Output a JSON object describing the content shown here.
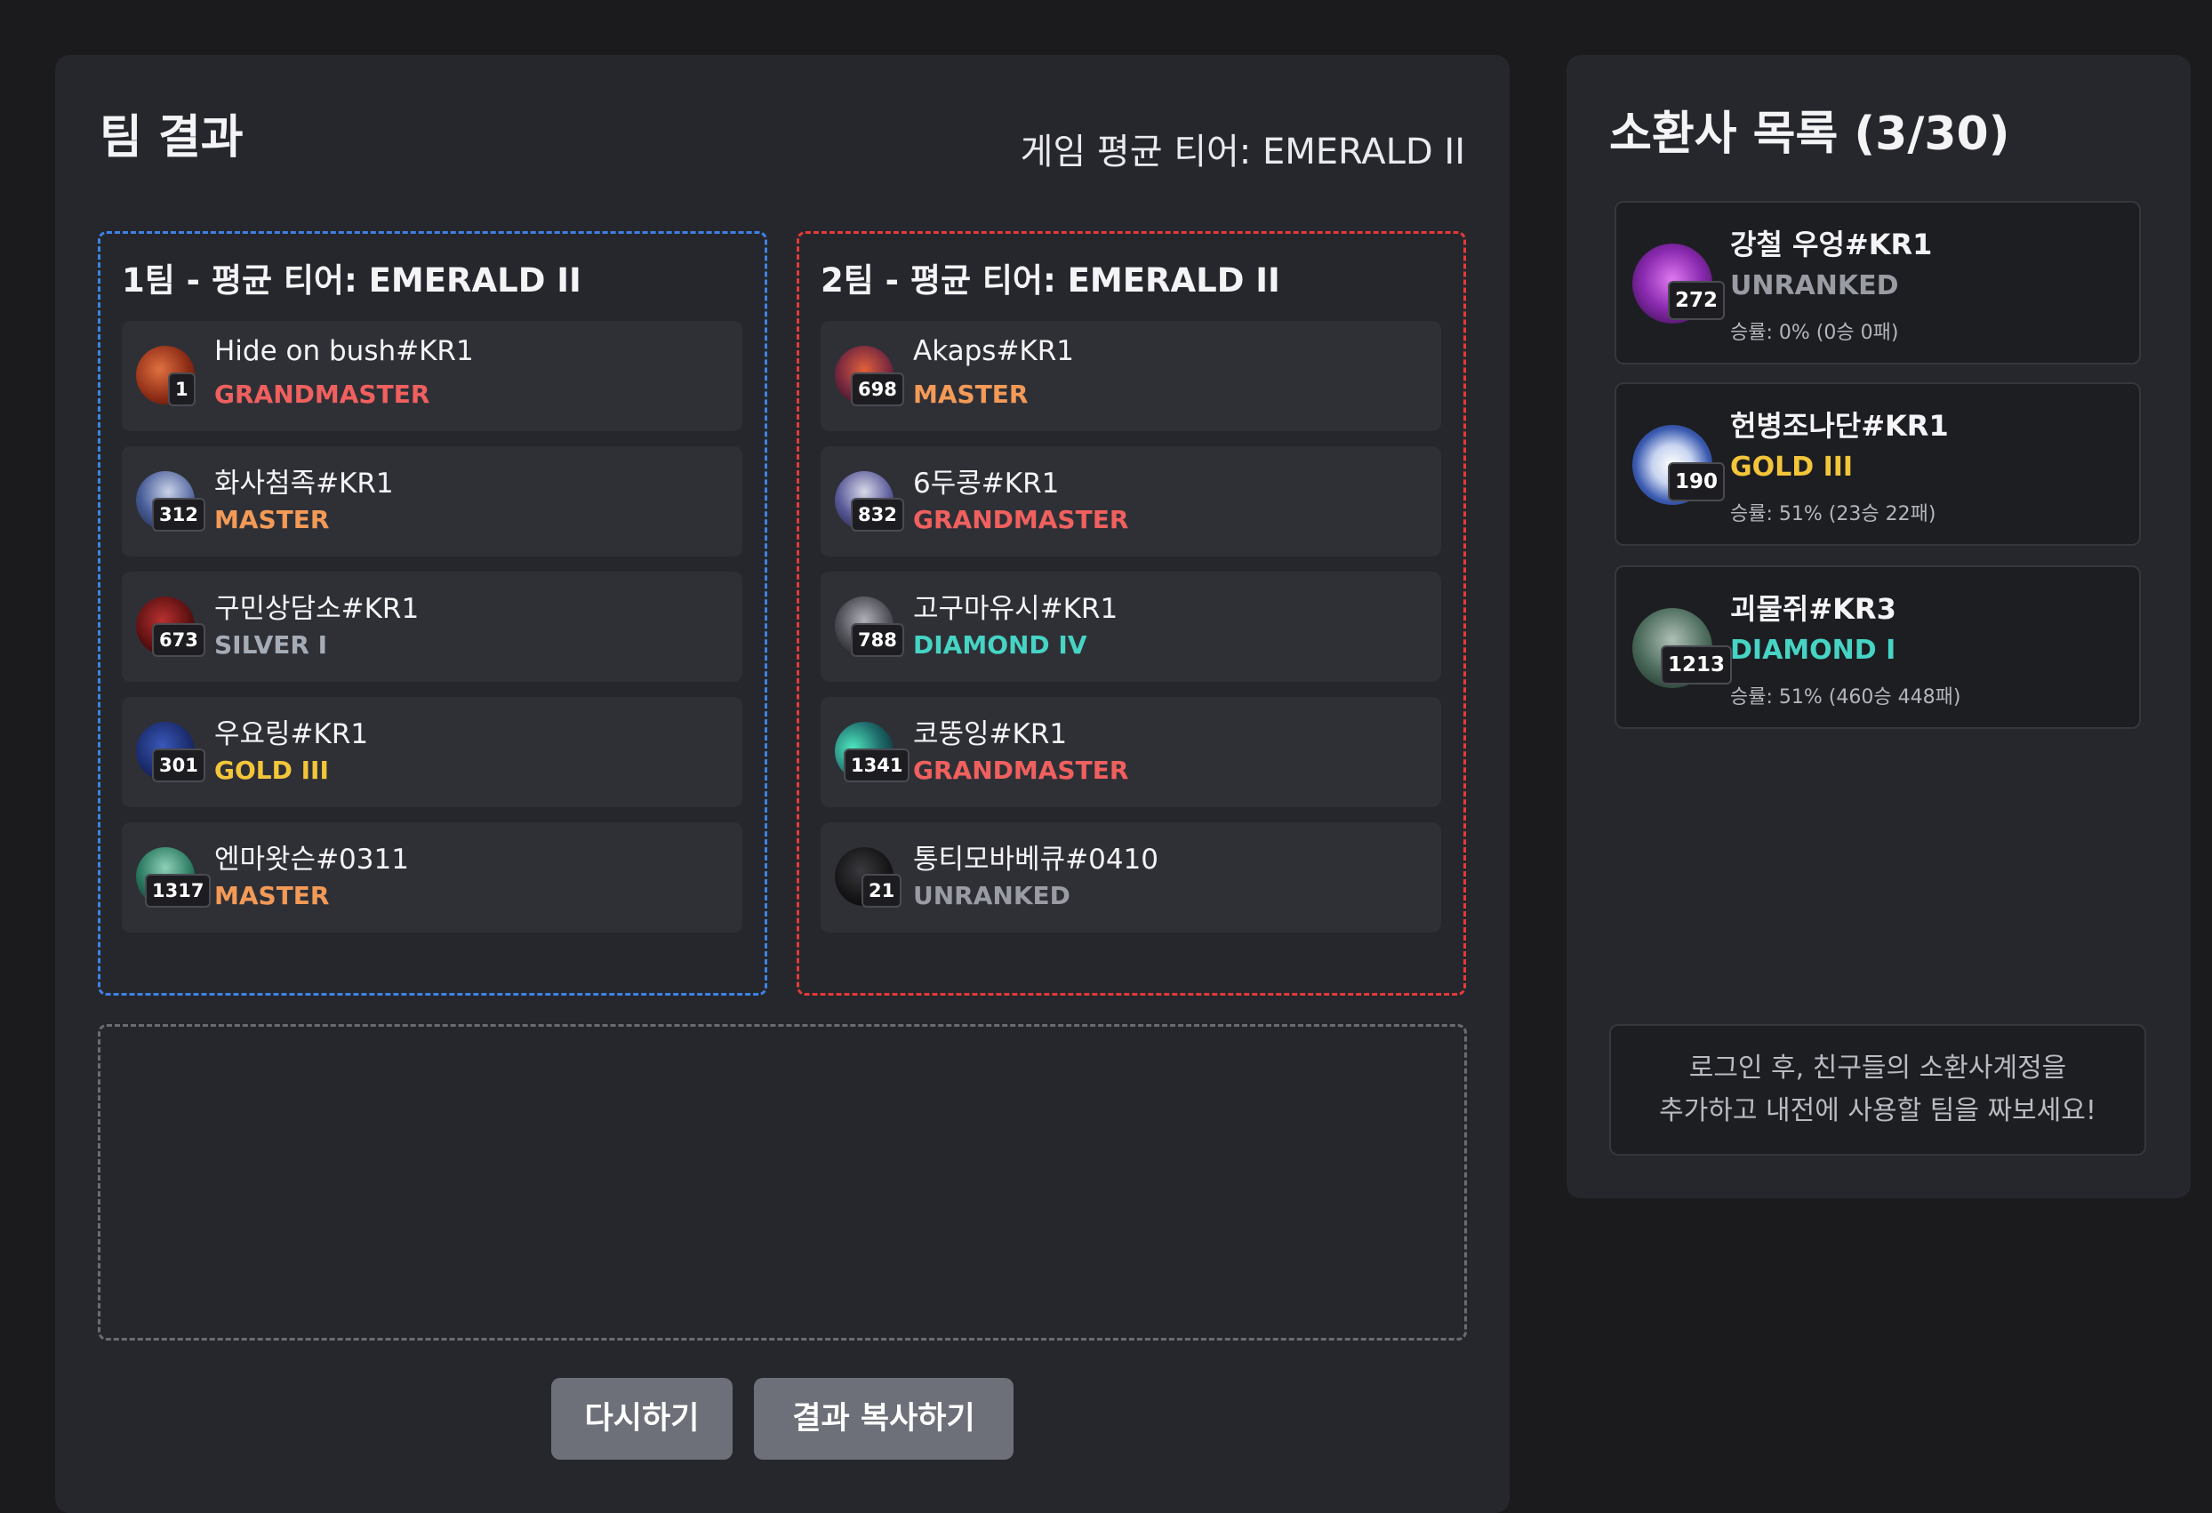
{
  "results": {
    "title": "팀 결과",
    "game_avg": "게임 평균 티어: EMERALD II",
    "team1": {
      "title": "1팀 - 평균 티어: EMERALD II",
      "players": [
        {
          "name": "Hide on bush#KR1",
          "level": "1",
          "tier": "GRANDMASTER",
          "tier_color": "#f0605e"
        },
        {
          "name": "화사첨족#KR1",
          "level": "312",
          "tier": "MASTER",
          "tier_color": "#f39a57"
        },
        {
          "name": "구민상담소#KR1",
          "level": "673",
          "tier": "SILVER I",
          "tier_color": "#a6acb6"
        },
        {
          "name": "우요링#KR1",
          "level": "301",
          "tier": "GOLD III",
          "tier_color": "#f3c63a"
        },
        {
          "name": "엔마왓슨#0311",
          "level": "1317",
          "tier": "MASTER",
          "tier_color": "#f39a57"
        }
      ]
    },
    "team2": {
      "title": "2팀 - 평균 티어: EMERALD II",
      "players": [
        {
          "name": "Akaps#KR1",
          "level": "698",
          "tier": "MASTER",
          "tier_color": "#f39a57"
        },
        {
          "name": "6두콩#KR1",
          "level": "832",
          "tier": "GRANDMASTER",
          "tier_color": "#f0605e"
        },
        {
          "name": "고구마유시#KR1",
          "level": "788",
          "tier": "DIAMOND IV",
          "tier_color": "#46d4c4"
        },
        {
          "name": "코뚱잉#KR1",
          "level": "1341",
          "tier": "GRANDMASTER",
          "tier_color": "#f0605e"
        },
        {
          "name": "통티모바베큐#0410",
          "level": "21",
          "tier": "UNRANKED",
          "tier_color": "#9a9ca4"
        }
      ]
    },
    "buttons": {
      "retry": "다시하기",
      "copy": "결과 복사하기"
    }
  },
  "summoners": {
    "title": "소환사 목록 (3/30)",
    "items": [
      {
        "name": "강철 우엉#KR1",
        "level": "272",
        "tier": "UNRANKED",
        "tier_color": "#9a9ca4",
        "winrate": "승률: 0% (0승 0패)"
      },
      {
        "name": "헌병조나단#KR1",
        "level": "190",
        "tier": "GOLD III",
        "tier_color": "#f3c63a",
        "winrate": "승률: 51% (23승 22패)"
      },
      {
        "name": "괴물쥐#KR3",
        "level": "1213",
        "tier": "DIAMOND I",
        "tier_color": "#46d4c4",
        "winrate": "승률: 51% (460승 448패)"
      }
    ],
    "login_notice": {
      "line1": "로그인 후, 친구들의 소환사계정을",
      "line2": "추가하고 내전에 사용할 팀을 짜보세요!"
    }
  },
  "colors": {
    "team1_border": "#3d82e8",
    "team2_border": "#e53a3a",
    "grandmaster": "#f0605e",
    "master": "#f39a57",
    "gold": "#f3c63a",
    "diamond": "#46d4c4",
    "silver": "#a6acb6",
    "unranked": "#9a9ca4"
  }
}
